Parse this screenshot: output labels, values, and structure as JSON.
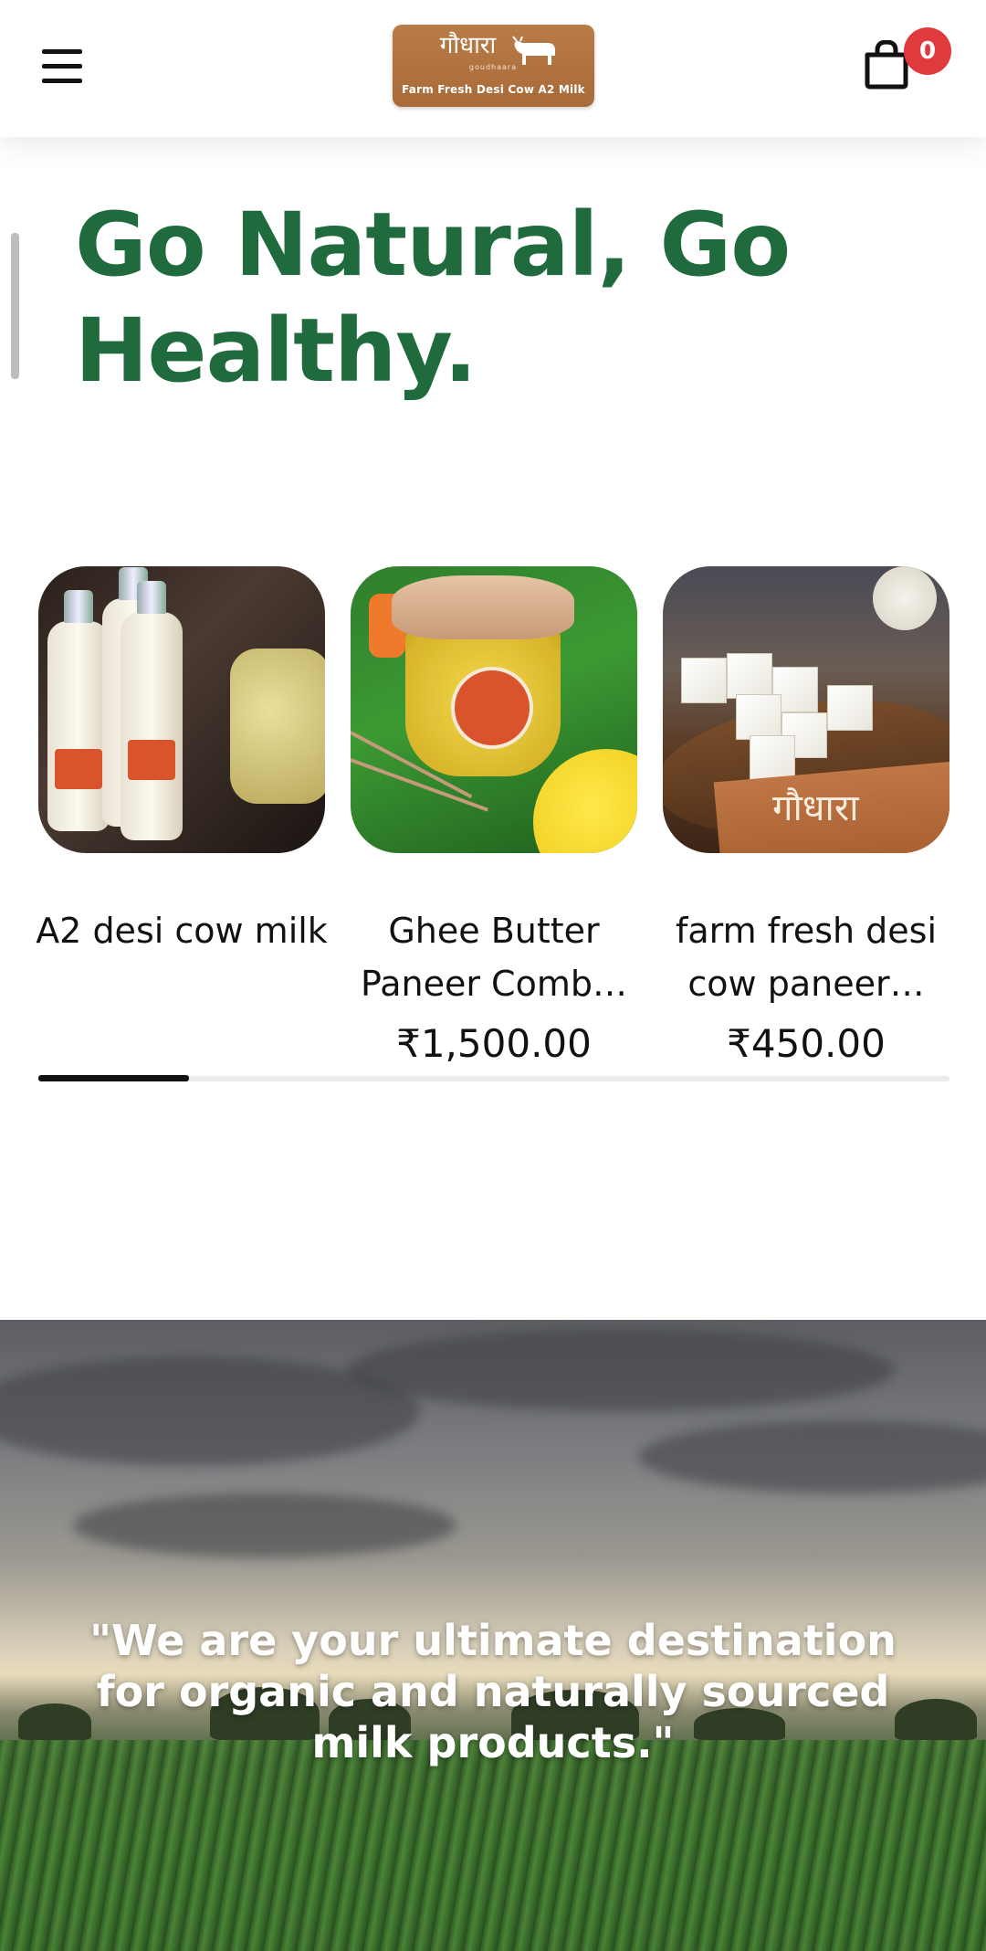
{
  "header": {
    "menu_icon": "hamburger-menu-icon",
    "logo": {
      "script_text": "गौधारा",
      "brand_text": "goudhaara",
      "tagline": "Farm Fresh Desi Cow A2 Milk"
    },
    "cart": {
      "icon": "shopping-bag-icon",
      "count": "0",
      "badge_color": "#e03a3e"
    }
  },
  "hero": {
    "title": "Go Natural, Go Healthy.",
    "title_color": "#1f6b3d"
  },
  "products": [
    {
      "name": "A2 desi cow milk",
      "price": ""
    },
    {
      "name": "Ghee Butter Paneer Comb…",
      "price": "₹1,500.00"
    },
    {
      "name": "farm fresh desi cow paneer…",
      "price": "₹450.00"
    }
  ],
  "carousel": {
    "progress": 0.165
  },
  "banner": {
    "quote": "\"We are your ultimate destination for organic and naturally sourced milk products.\""
  }
}
